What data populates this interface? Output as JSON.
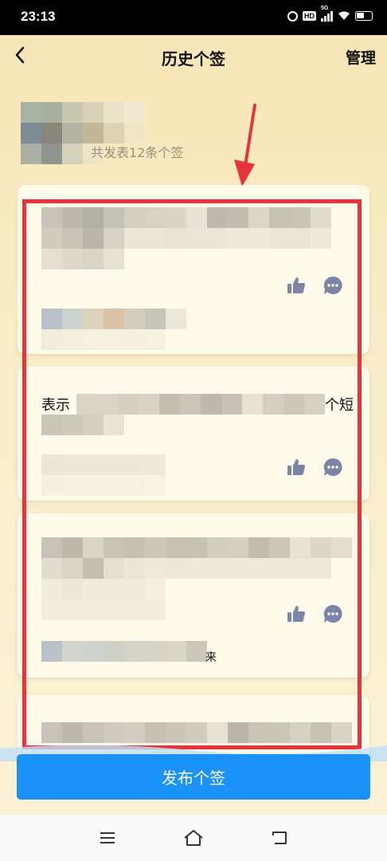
{
  "status_bar": {
    "time": "23:13",
    "network": "5G",
    "hd_badge": "HD",
    "icons": [
      "alarm-icon",
      "hd-icon",
      "signal-icon",
      "wifi-icon",
      "battery-icon"
    ]
  },
  "header": {
    "back_icon": "chevron-left-icon",
    "title": "历史个签",
    "manage_label": "管理"
  },
  "profile": {
    "avatar": "pixelated-avatar",
    "summary_text": "共发表12条个签"
  },
  "annotations": {
    "arrow_color": "#e8333a",
    "box_color": "#e8333a"
  },
  "cards": [
    {
      "content": "pixelated",
      "actions": [
        "thumb-up-icon",
        "comment-icon"
      ]
    },
    {
      "visible_text_start": "表示",
      "visible_text_end": "个短",
      "actions": [
        "thumb-up-icon",
        "comment-icon"
      ]
    },
    {
      "content": "pixelated",
      "trailing_text": "来",
      "actions": [
        "thumb-up-icon",
        "comment-icon"
      ]
    },
    {
      "content": "pixelated",
      "actions": []
    }
  ],
  "publish_button": {
    "label": "发布个签",
    "color": "#1a92f7"
  },
  "system_nav": {
    "icons": [
      "menu-icon",
      "home-icon",
      "back-icon"
    ]
  }
}
